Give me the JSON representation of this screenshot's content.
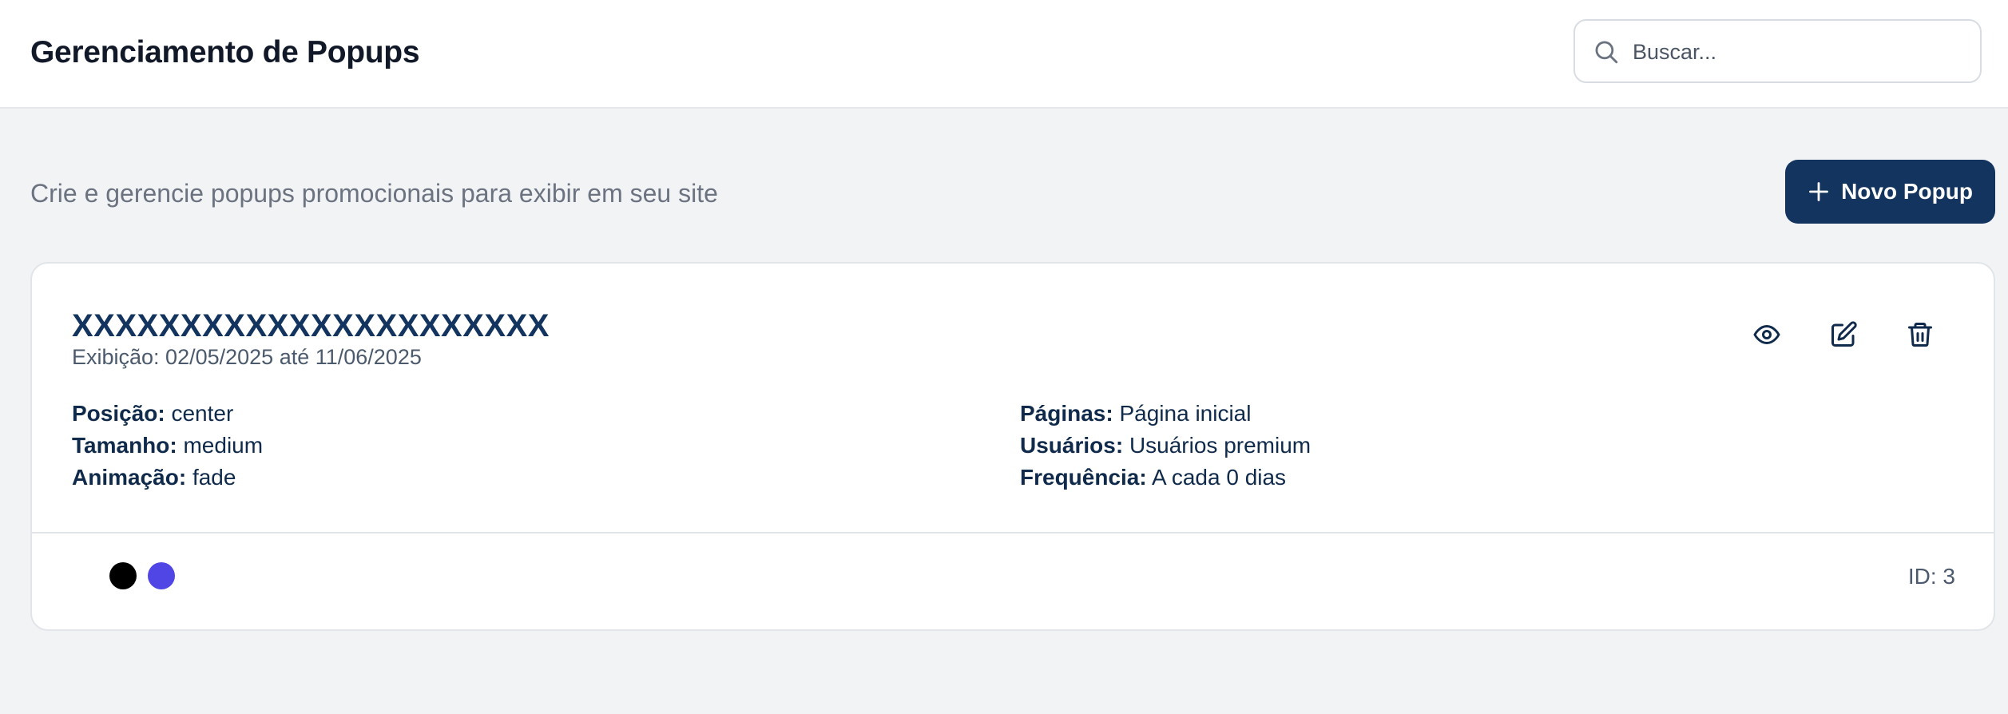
{
  "header": {
    "title": "Gerenciamento de Popups",
    "search": {
      "placeholder": "Buscar...",
      "value": ""
    }
  },
  "main": {
    "subtitle": "Crie e gerencie popups promocionais para exibir em seu site",
    "new_button_label": "Novo Popup"
  },
  "popups": [
    {
      "title": "XXXXXXXXXXXXXXXXXXXXXX",
      "display_label": "Exibição: 02/05/2025 até 11/06/2025",
      "position_label": "Posição:",
      "position": "center",
      "size_label": "Tamanho:",
      "size": "medium",
      "animation_label": "Animação:",
      "animation": "fade",
      "pages_label": "Páginas:",
      "pages": "Página inicial",
      "users_label": "Usuários:",
      "users": "Usuários premium",
      "frequency_label": "Frequência:",
      "frequency": "A cada 0 dias",
      "colors": [
        "#000000",
        "#4f46e5"
      ],
      "id_label": "ID: 3"
    }
  ],
  "icons": {
    "search": "search-icon",
    "plus": "plus-icon",
    "view": "eye-icon",
    "edit": "edit-icon",
    "delete": "trash-icon"
  },
  "theme": {
    "brand": "#12345e",
    "background": "#f2f3f5"
  }
}
